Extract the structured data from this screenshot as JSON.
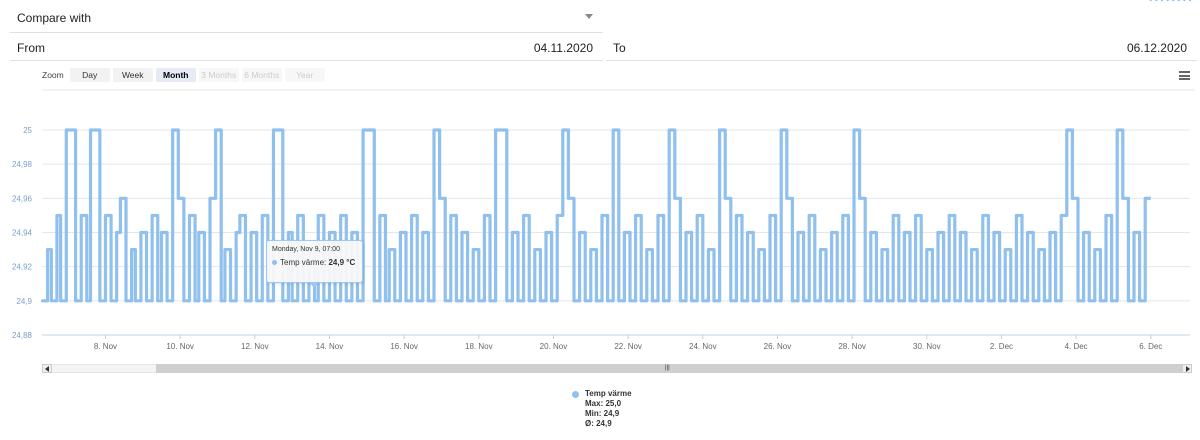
{
  "compare": {
    "label": "Compare with"
  },
  "from": {
    "label": "From",
    "value": "04.11.2020"
  },
  "to": {
    "label": "To",
    "value": "06.12.2020"
  },
  "zoom": {
    "label": "Zoom",
    "buttons": [
      {
        "label": "Day",
        "state": "normal"
      },
      {
        "label": "Week",
        "state": "normal"
      },
      {
        "label": "Month",
        "state": "active"
      },
      {
        "label": "3 Months",
        "state": "disabled"
      },
      {
        "label": "6 Months",
        "state": "disabled"
      },
      {
        "label": "Year",
        "state": "disabled"
      }
    ]
  },
  "tooltip": {
    "date": "Monday, Nov 9, 07:00",
    "series": "Temp värme",
    "value": "24,9 °C"
  },
  "legend": {
    "name": "Temp värme",
    "max": "Max: 25,0",
    "min": "Min: 24,9",
    "avg": "Ø: 24,9"
  },
  "colors": {
    "series": "#90c0ed",
    "grid": "#e6e6e6",
    "axis_text": "#666666"
  },
  "chart_data": {
    "type": "line",
    "title": "",
    "xlabel": "",
    "ylabel": "",
    "ylim": [
      24.88,
      25.0
    ],
    "y_ticks": [
      "24,88",
      "24,9",
      "24,92",
      "24,94",
      "24,96",
      "24,98",
      "25"
    ],
    "x_tick_labels": [
      "8. Nov",
      "10. Nov",
      "12. Nov",
      "14. Nov",
      "16. Nov",
      "18. Nov",
      "20. Nov",
      "22. Nov",
      "24. Nov",
      "26. Nov",
      "28. Nov",
      "30. Nov",
      "2. Dec",
      "4. Dec",
      "6. Dec"
    ],
    "x_range_days": [
      6.3,
      37.05
    ],
    "series": [
      {
        "name": "Temp värme",
        "x_days": [
          6.3,
          6.45,
          6.55,
          6.7,
          6.8,
          6.95,
          7.1,
          7.2,
          7.35,
          7.5,
          7.6,
          7.75,
          7.85,
          8.0,
          8.15,
          8.3,
          8.4,
          8.55,
          8.7,
          8.8,
          8.95,
          9.1,
          9.25,
          9.4,
          9.5,
          9.65,
          9.8,
          9.95,
          10.1,
          10.25,
          10.4,
          10.5,
          10.65,
          10.8,
          10.95,
          11.1,
          11.2,
          11.35,
          11.5,
          11.6,
          11.75,
          11.9,
          12.05,
          12.2,
          12.35,
          12.5,
          12.6,
          12.75,
          12.9,
          13.0,
          13.15,
          13.3,
          13.45,
          13.6,
          13.7,
          13.85,
          14.0,
          14.15,
          14.3,
          14.45,
          14.6,
          14.75,
          14.9,
          15.05,
          15.2,
          15.35,
          15.5,
          15.6,
          15.75,
          15.9,
          16.05,
          16.2,
          16.35,
          16.5,
          16.65,
          16.8,
          16.95,
          17.1,
          17.25,
          17.4,
          17.55,
          17.7,
          17.85,
          18.0,
          18.15,
          18.3,
          18.45,
          18.6,
          18.75,
          18.9,
          19.05,
          19.2,
          19.35,
          19.5,
          19.65,
          19.8,
          19.95,
          20.1,
          20.25,
          20.4,
          20.55,
          20.7,
          20.85,
          21.0,
          21.15,
          21.3,
          21.45,
          21.6,
          21.75,
          21.9,
          22.05,
          22.2,
          22.35,
          22.5,
          22.65,
          22.8,
          22.95,
          23.1,
          23.25,
          23.4,
          23.55,
          23.7,
          23.85,
          24.0,
          24.15,
          24.3,
          24.45,
          24.6,
          24.75,
          24.9,
          25.05,
          25.2,
          25.35,
          25.5,
          25.65,
          25.8,
          25.95,
          26.1,
          26.25,
          26.4,
          26.55,
          26.7,
          26.85,
          27.0,
          27.15,
          27.3,
          27.45,
          27.6,
          27.75,
          27.9,
          28.05,
          28.2,
          28.35,
          28.5,
          28.65,
          28.8,
          28.95,
          29.1,
          29.25,
          29.4,
          29.55,
          29.7,
          29.85,
          30.0,
          30.15,
          30.3,
          30.45,
          30.6,
          30.75,
          30.9,
          31.05,
          31.2,
          31.35,
          31.5,
          31.65,
          31.8,
          31.95,
          32.1,
          32.25,
          32.4,
          32.55,
          32.7,
          32.85,
          33.0,
          33.15,
          33.3,
          33.45,
          33.6,
          33.75,
          33.9,
          34.05,
          34.2,
          34.35,
          34.5,
          34.65,
          34.8,
          34.95,
          35.1,
          35.25,
          35.4,
          35.55,
          35.7,
          35.85,
          36.0,
          36.15,
          36.3,
          36.45,
          36.6,
          36.75,
          36.9,
          37.05
        ],
        "values": [
          24.9,
          24.93,
          24.9,
          24.95,
          24.9,
          25.0,
          25.0,
          24.9,
          24.95,
          24.9,
          25.0,
          25.0,
          24.9,
          24.95,
          24.9,
          24.94,
          24.96,
          24.9,
          24.93,
          24.9,
          24.94,
          24.9,
          24.95,
          24.9,
          24.94,
          24.9,
          25.0,
          24.96,
          24.9,
          24.95,
          24.9,
          24.94,
          24.9,
          24.96,
          25.0,
          24.9,
          24.93,
          24.9,
          24.94,
          24.95,
          24.9,
          24.94,
          24.9,
          24.95,
          24.9,
          25.0,
          25.0,
          24.9,
          24.94,
          24.9,
          24.95,
          24.9,
          24.93,
          24.9,
          24.95,
          24.9,
          24.94,
          24.9,
          24.95,
          24.9,
          24.94,
          24.9,
          25.0,
          25.0,
          24.9,
          24.95,
          24.9,
          24.93,
          24.9,
          24.94,
          24.9,
          24.95,
          24.9,
          24.94,
          24.9,
          25.0,
          24.96,
          24.9,
          24.95,
          24.9,
          24.94,
          24.9,
          24.93,
          24.9,
          24.95,
          24.9,
          25.0,
          25.0,
          24.9,
          24.94,
          24.9,
          24.95,
          24.9,
          24.93,
          24.9,
          24.94,
          24.9,
          24.95,
          25.0,
          24.96,
          24.9,
          24.94,
          24.9,
          24.93,
          24.9,
          24.95,
          24.9,
          25.0,
          24.9,
          24.94,
          24.9,
          24.95,
          24.9,
          24.93,
          24.9,
          24.95,
          24.9,
          25.0,
          24.96,
          24.9,
          24.94,
          24.9,
          24.95,
          24.9,
          24.93,
          24.9,
          25.0,
          24.96,
          24.9,
          24.95,
          24.9,
          24.94,
          24.9,
          24.93,
          24.9,
          24.95,
          24.9,
          25.0,
          24.96,
          24.9,
          24.94,
          24.9,
          24.95,
          24.9,
          24.93,
          24.9,
          24.94,
          24.9,
          24.95,
          24.9,
          25.0,
          24.96,
          24.9,
          24.94,
          24.9,
          24.93,
          24.9,
          24.95,
          24.9,
          24.94,
          24.9,
          24.95,
          24.9,
          24.93,
          24.9,
          24.94,
          24.9,
          24.95,
          24.9,
          24.94,
          24.9,
          24.93,
          24.9,
          24.95,
          24.9,
          24.94,
          24.9,
          24.93,
          24.9,
          24.95,
          24.9,
          24.94,
          24.9,
          24.93,
          24.9,
          24.94,
          24.9,
          24.95,
          25.0,
          24.96,
          24.9,
          24.94,
          24.9,
          24.93,
          24.9,
          24.95,
          24.9,
          25.0,
          24.96,
          24.9,
          24.94,
          24.9,
          24.96
        ]
      }
    ],
    "grid": true,
    "legend_position": "bottom-center"
  }
}
